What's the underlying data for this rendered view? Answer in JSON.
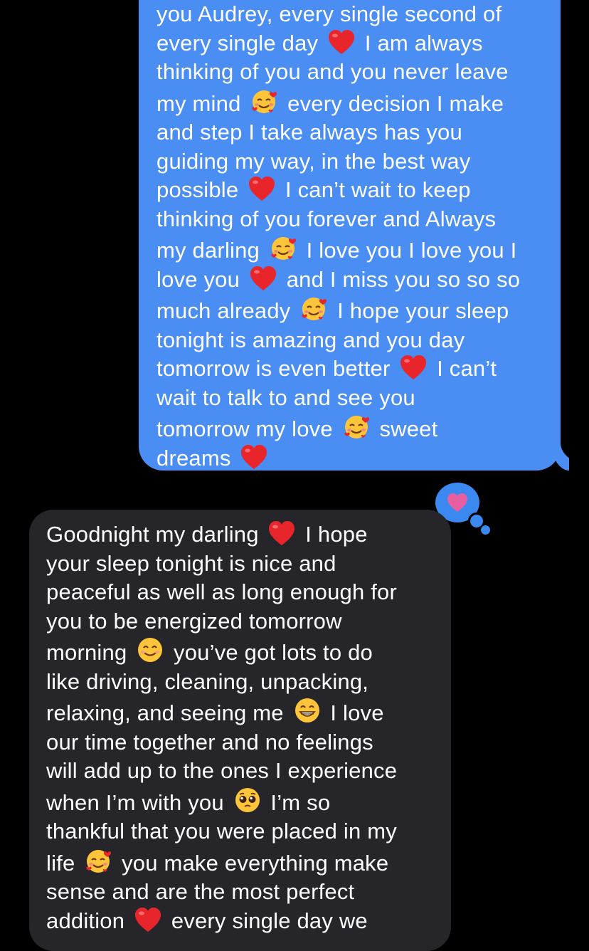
{
  "conversation": {
    "outgoing_message": {
      "lines": [
        [
          "you Audrey, every single second of"
        ],
        [
          "every single day ",
          "{heart}",
          " I am always"
        ],
        [
          "thinking of you and you never leave"
        ],
        [
          "my mind ",
          "{love}",
          " every decision I make"
        ],
        [
          "and step I take always has you"
        ],
        [
          "guiding my way, in the best way"
        ],
        [
          "possible ",
          "{heart}",
          " I can’t wait to keep"
        ],
        [
          "thinking of you forever and Always"
        ],
        [
          "my darling ",
          "{love}",
          " I love you I love you I"
        ],
        [
          "love you ",
          "{heart}",
          " and I miss you so so so"
        ],
        [
          "much already ",
          "{love}",
          " I hope your sleep"
        ],
        [
          "tonight is amazing and you day"
        ],
        [
          "tomorrow is even better ",
          "{heart}",
          " I can’t"
        ],
        [
          "wait to talk to and see you"
        ],
        [
          "tomorrow my love ",
          "{love}",
          " sweet"
        ],
        [
          "dreams ",
          "{heart}"
        ]
      ]
    },
    "tapback": {
      "icon": "heart-icon",
      "color": "#e85fa1"
    },
    "incoming_message": {
      "lines": [
        [
          "Goodnight my darling ",
          "{heart}",
          " I hope"
        ],
        [
          "your sleep tonight is nice and"
        ],
        [
          "peaceful as well as long enough for"
        ],
        [
          "you to be energized tomorrow"
        ],
        [
          "morning ",
          "{smile}",
          " you’ve got lots to do"
        ],
        [
          "like driving, cleaning, unpacking,"
        ],
        [
          "relaxing, and seeing me ",
          "{grin}",
          " I love"
        ],
        [
          "our time together and no feelings"
        ],
        [
          "will add up to the ones I experience"
        ],
        [
          "when I’m with you ",
          "{pleading}",
          " I’m so"
        ],
        [
          "thankful that you were placed in my"
        ],
        [
          "life ",
          "{love}",
          " you make everything make"
        ],
        [
          "sense and are the most perfect"
        ],
        [
          "addition ",
          "{heart}",
          " every single day we"
        ]
      ]
    }
  },
  "colors": {
    "background": "#000000",
    "outgoing_bubble": "#4a8ef4",
    "incoming_bubble": "#26262a",
    "text": "#ffffff"
  }
}
